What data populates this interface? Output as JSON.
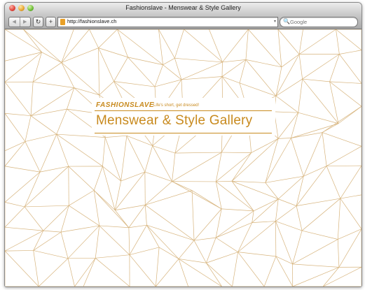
{
  "browser": {
    "window_title": "Fashionslave - Menswear & Style Gallery",
    "back_glyph": "◀",
    "forward_glyph": "▶",
    "reload_glyph": "↻",
    "add_glyph": "+",
    "url": "http://fashionslave.ch",
    "search_placeholder": "Google",
    "search_icon_glyph": "🔍",
    "go_glyph": "▾"
  },
  "page": {
    "brand": "FASHIONSLAVE",
    "tagline": "Life's short, get dressed!",
    "heading": "Menswear & Style Gallery",
    "accent_color": "#c88a1e",
    "mesh_color": "#d7b47d"
  }
}
